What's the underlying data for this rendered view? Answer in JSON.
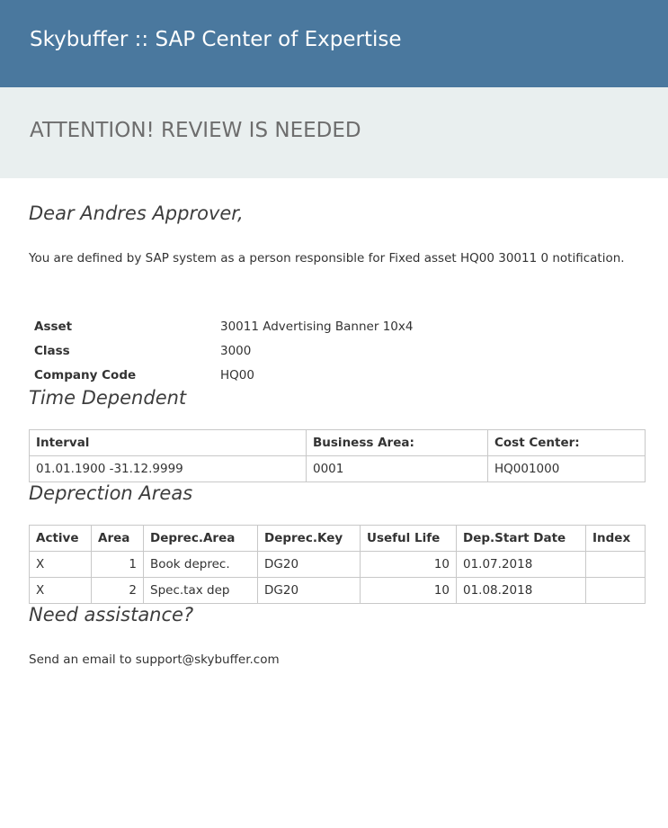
{
  "header": {
    "title": "Skybuffer :: SAP Center of Expertise"
  },
  "attention": {
    "title": "ATTENTION! REVIEW IS NEEDED"
  },
  "greeting": "Dear Andres Approver,",
  "intro": "You are defined by SAP system as a person responsible for Fixed asset HQ00 30011 0 notification.",
  "asset_info": [
    {
      "label": "Asset",
      "value": "30011 Advertising Banner 10x4"
    },
    {
      "label": "Class",
      "value": "3000"
    },
    {
      "label": "Company Code",
      "value": "HQ00"
    }
  ],
  "time_dependent": {
    "title": "Time Dependent",
    "headers": [
      "Interval",
      "Business Area:",
      "Cost Center:"
    ],
    "rows": [
      [
        "01.01.1900 -31.12.9999",
        "0001",
        "HQ001000"
      ]
    ]
  },
  "deprec_areas": {
    "title": "Deprection Areas",
    "headers": [
      "Active",
      "Area",
      "Deprec.Area",
      "Deprec.Key",
      "Useful Life",
      "Dep.Start Date",
      "Index"
    ],
    "rows": [
      [
        "X",
        "1",
        "Book deprec.",
        "DG20",
        "10",
        "01.07.2018",
        ""
      ],
      [
        "X",
        "2",
        "Spec.tax dep",
        "DG20",
        "10",
        "01.08.2018",
        ""
      ]
    ]
  },
  "assistance": {
    "title": "Need assistance?",
    "text": "Send an email to support@skybuffer.com"
  }
}
